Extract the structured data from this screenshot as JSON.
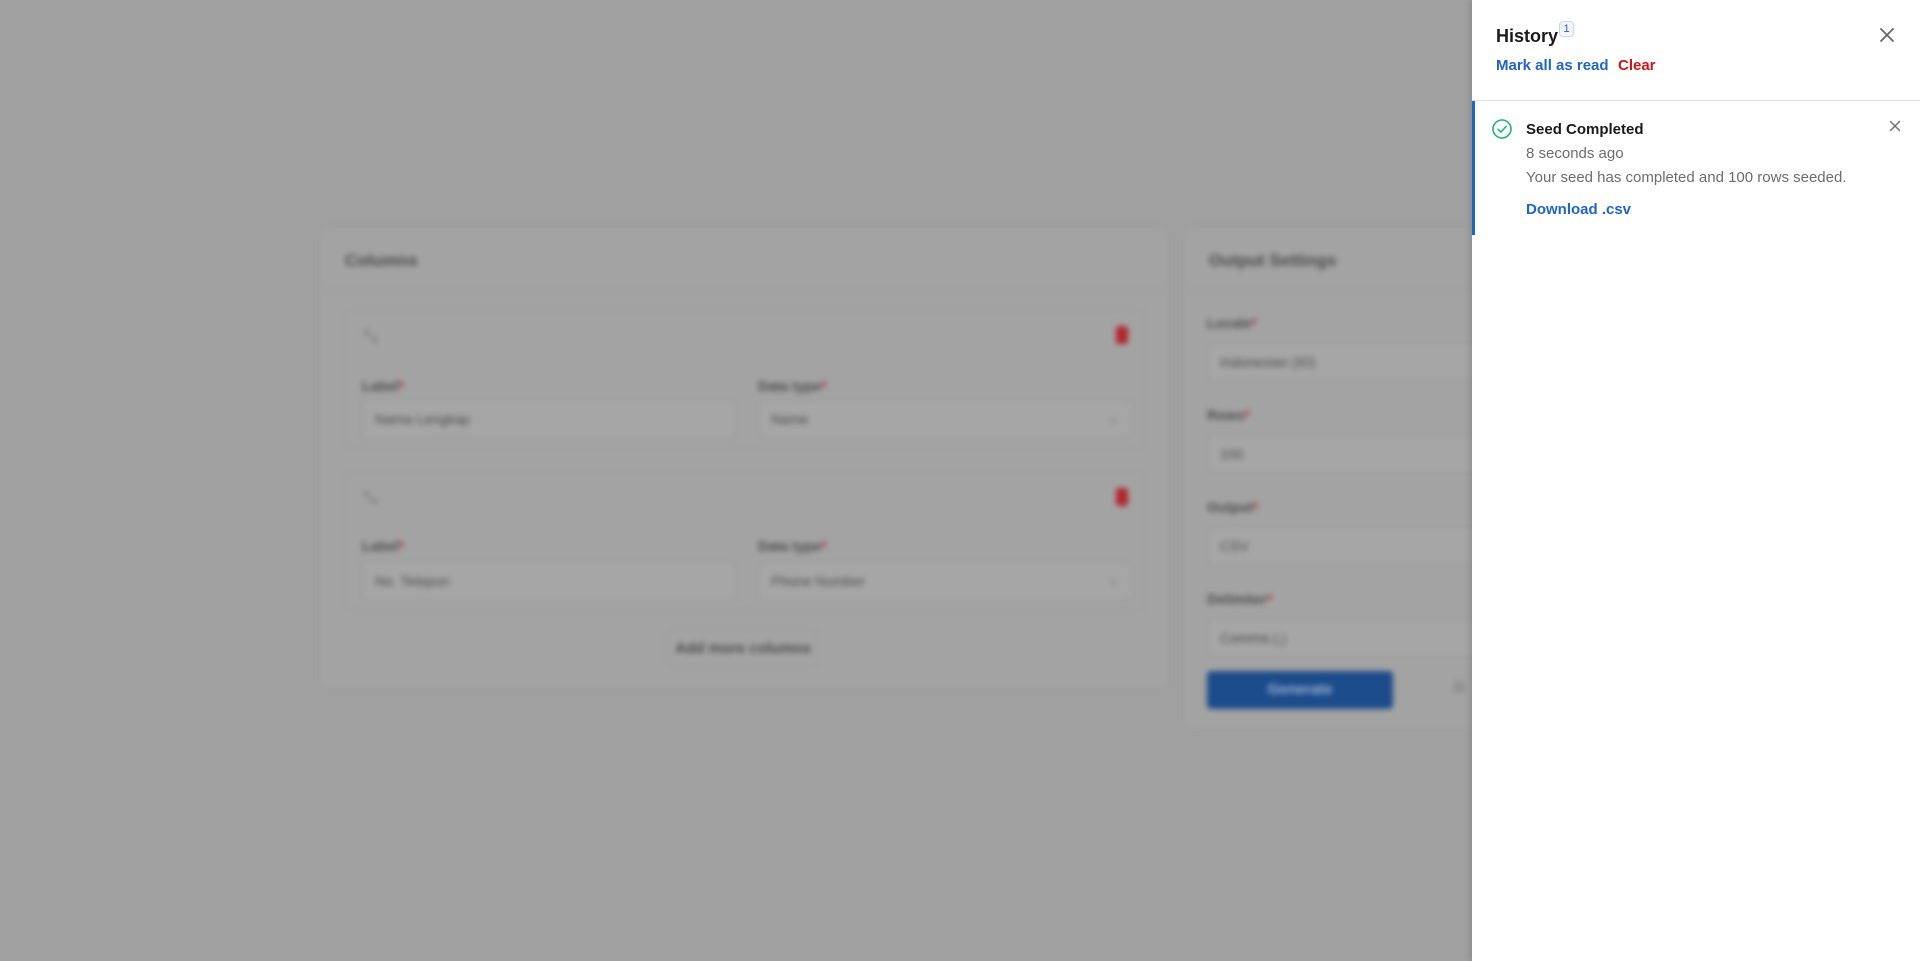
{
  "background": {
    "columns_card": {
      "title": "Columns",
      "columns": [
        {
          "label_title": "Label",
          "label_value": "Nama Lengkap",
          "type_title": "Data type",
          "type_value": "Name"
        },
        {
          "label_title": "Label",
          "label_value": "No. Telepon",
          "type_title": "Data type",
          "type_value": "Phone Number"
        }
      ],
      "add_more_label": "Add more columns"
    },
    "output_card": {
      "title": "Output Settings",
      "locale_label": "Locale",
      "locale_value": "Indonesian (ID)",
      "rows_label": "Rows",
      "rows_value": "100",
      "output_label": "Output",
      "output_value": "CSV",
      "delimiter_label": "Delimiter",
      "delimiter_value": "Comma (,)",
      "generate_label": "Generate"
    },
    "required_mark": "*"
  },
  "drawer": {
    "title": "History",
    "unread_count": "1",
    "mark_all_read_label": "Mark all as read",
    "clear_label": "Clear",
    "notifications": [
      {
        "title": "Seed Completed",
        "time": "8 seconds ago",
        "message": "Your seed has completed and 100 rows seeded.",
        "action_label": "Download .csv",
        "status_icon": "check-circle-icon",
        "status_color": "#22b573"
      }
    ]
  },
  "colors": {
    "accent": "#1f66c4",
    "danger": "#d41414",
    "success": "#22b573"
  }
}
